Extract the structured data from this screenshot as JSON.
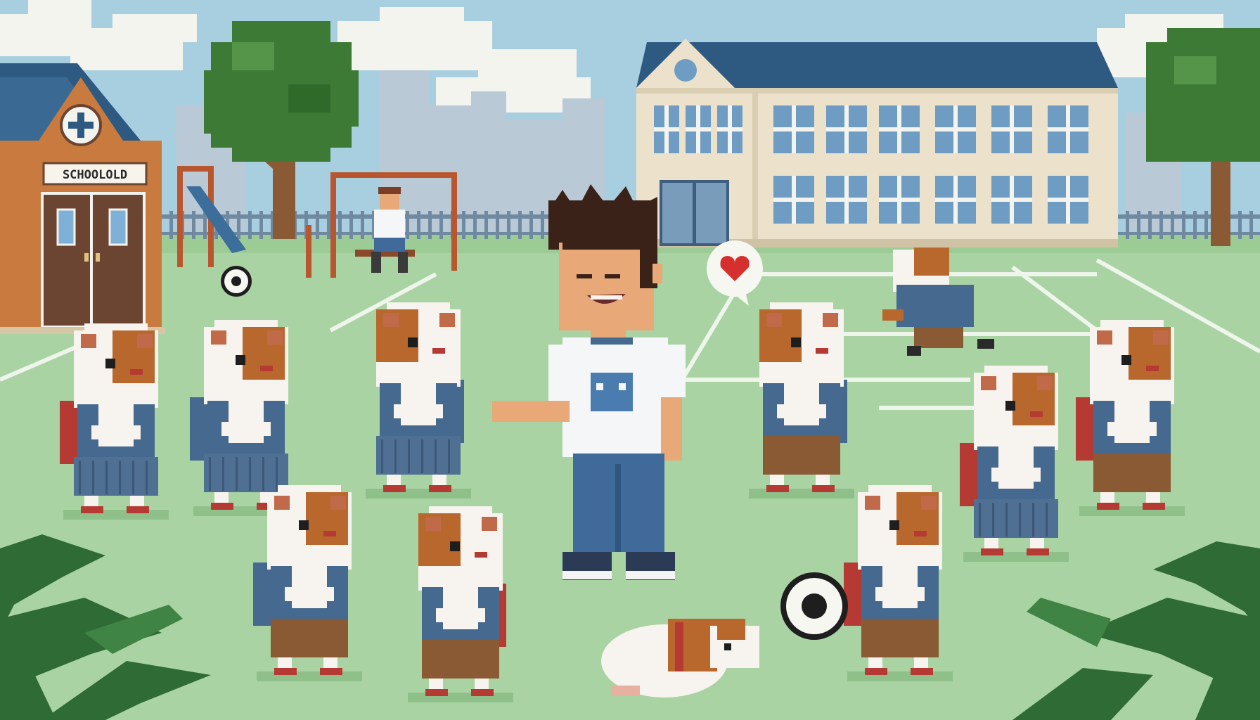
{
  "scene": {
    "kind": "pixel-art illustration",
    "sign_text": "SCHOOLOLD"
  },
  "colors": {
    "sky": "#a8cfe0",
    "cloud": "#f4f4ef",
    "city": "#b9c9d6",
    "grass": "#a9d3a3",
    "grass_dark": "#8fc08a",
    "field_line": "#eef5ea",
    "roof": "#2e5a82",
    "school_wall": "#ece2cc",
    "window": "#6e9cc3",
    "shed_wall": "#c87a3f",
    "door": "#6b4532",
    "tree_leaf": "#3d7a36",
    "tree_trunk": "#8a5a34",
    "fence": "#6f8aa0",
    "fur_orange": "#b9682d",
    "fur_white": "#f7f3ee",
    "uniform_blue": "#45698f",
    "skirt_blue": "#4f6f93",
    "shorts_brown": "#8a5a34",
    "backpack_red": "#b53a33",
    "boy_skin": "#e8a878",
    "boy_hair": "#3a2218",
    "boy_shirt": "#f4f6f8",
    "boy_jeans": "#3f6a99",
    "heart": "#d5302e",
    "ball_black": "#1e1e1e",
    "plant": "#2f6b34"
  },
  "icons": [
    "heart-icon",
    "soccer-ball-icon",
    "cross-emblem-icon"
  ]
}
